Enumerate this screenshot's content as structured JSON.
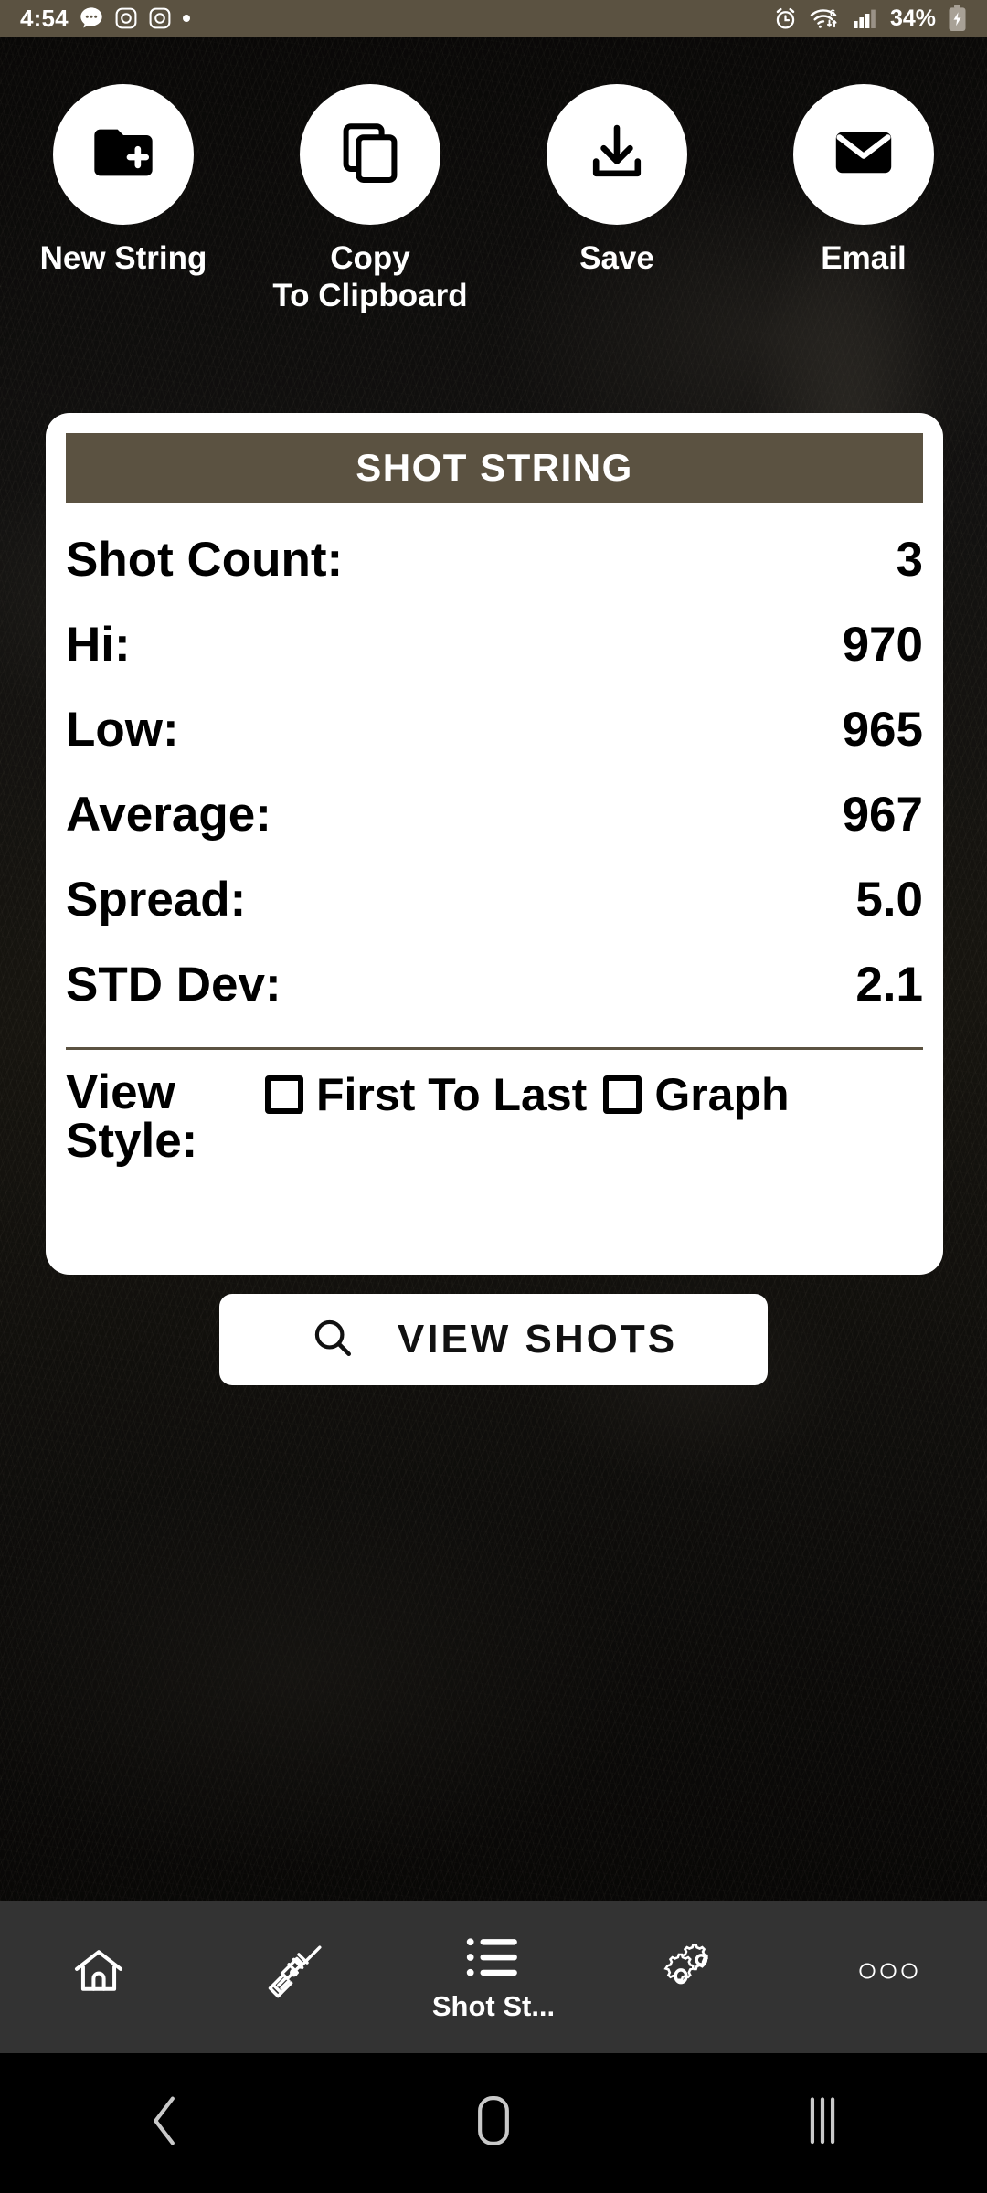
{
  "status_bar": {
    "time": "4:54",
    "battery_percent": "34%",
    "left_icons": [
      "message-bubble-icon",
      "instagram-icon",
      "instagram-icon",
      "dot-icon"
    ],
    "right_icons": [
      "alarm-icon",
      "wifi-6-icon",
      "cellular-signal-icon",
      "battery-charging-icon"
    ],
    "background_color": "#5b5241"
  },
  "actions": [
    {
      "label": "New String",
      "icon": "new-folder-icon"
    },
    {
      "label": "Copy\nTo Clipboard",
      "icon": "copy-icon"
    },
    {
      "label": "Save",
      "icon": "download-icon"
    },
    {
      "label": "Email",
      "icon": "envelope-icon"
    }
  ],
  "card": {
    "title": "SHOT STRING",
    "header_color": "#5b5241",
    "stats": [
      {
        "label": "Shot Count:",
        "value": "3"
      },
      {
        "label": "Hi:",
        "value": "970"
      },
      {
        "label": "Low:",
        "value": "965"
      },
      {
        "label": "Average:",
        "value": "967"
      },
      {
        "label": "Spread:",
        "value": "5.0"
      },
      {
        "label": "STD Dev:",
        "value": "2.1"
      }
    ],
    "view_style": {
      "label": "View\nStyle:",
      "options": [
        {
          "label": "First To Last",
          "checked": false
        },
        {
          "label": "Graph",
          "checked": false
        }
      ]
    }
  },
  "view_shots_button": {
    "label": "VIEW SHOTS",
    "icon": "search-icon"
  },
  "app_nav": {
    "background_color": "#333333",
    "items": [
      {
        "label": "",
        "icon": "home-icon",
        "active": false
      },
      {
        "label": "",
        "icon": "rifle-scope-icon",
        "active": false
      },
      {
        "label": "Shot St...",
        "icon": "list-icon",
        "active": true
      },
      {
        "label": "",
        "icon": "gears-icon",
        "active": false
      },
      {
        "label": "",
        "icon": "overflow-dots-icon",
        "active": false
      }
    ]
  },
  "system_nav": {
    "buttons": [
      "back-icon",
      "home-icon",
      "recents-icon"
    ]
  }
}
